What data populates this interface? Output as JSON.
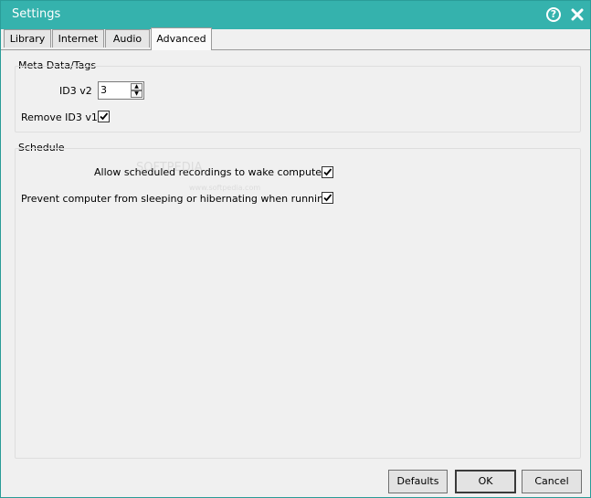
{
  "window": {
    "title": "Settings"
  },
  "titlebar": {
    "help_icon": "question-mark-icon",
    "help_glyph": "?",
    "close_icon": "close-x-icon"
  },
  "tabs": [
    {
      "label": "Library",
      "active": false
    },
    {
      "label": "Internet",
      "active": false
    },
    {
      "label": "Audio",
      "active": false
    },
    {
      "label": "Advanced",
      "active": true
    }
  ],
  "meta": {
    "group_title": "Meta Data/Tags",
    "id3v2_label": "ID3 v2",
    "id3v2_value": "3",
    "remove_id3v1_label": "Remove ID3 v1",
    "remove_id3v1_checked": true
  },
  "schedule": {
    "group_title": "Schedule",
    "wake_label": "Allow scheduled recordings to wake computer",
    "wake_checked": true,
    "prevent_sleep_label": "Prevent computer from sleeping or hibernating when running",
    "prevent_sleep_checked": true
  },
  "watermark": {
    "text": "SOFTPEDIA",
    "small": "www.softpedia.com"
  },
  "buttons": {
    "defaults": "Defaults",
    "ok": "OK",
    "cancel": "Cancel"
  },
  "colors": {
    "titlebar": "#35b2ad",
    "window_bg": "#f0f0f0",
    "tab_active": "#fafafa"
  }
}
